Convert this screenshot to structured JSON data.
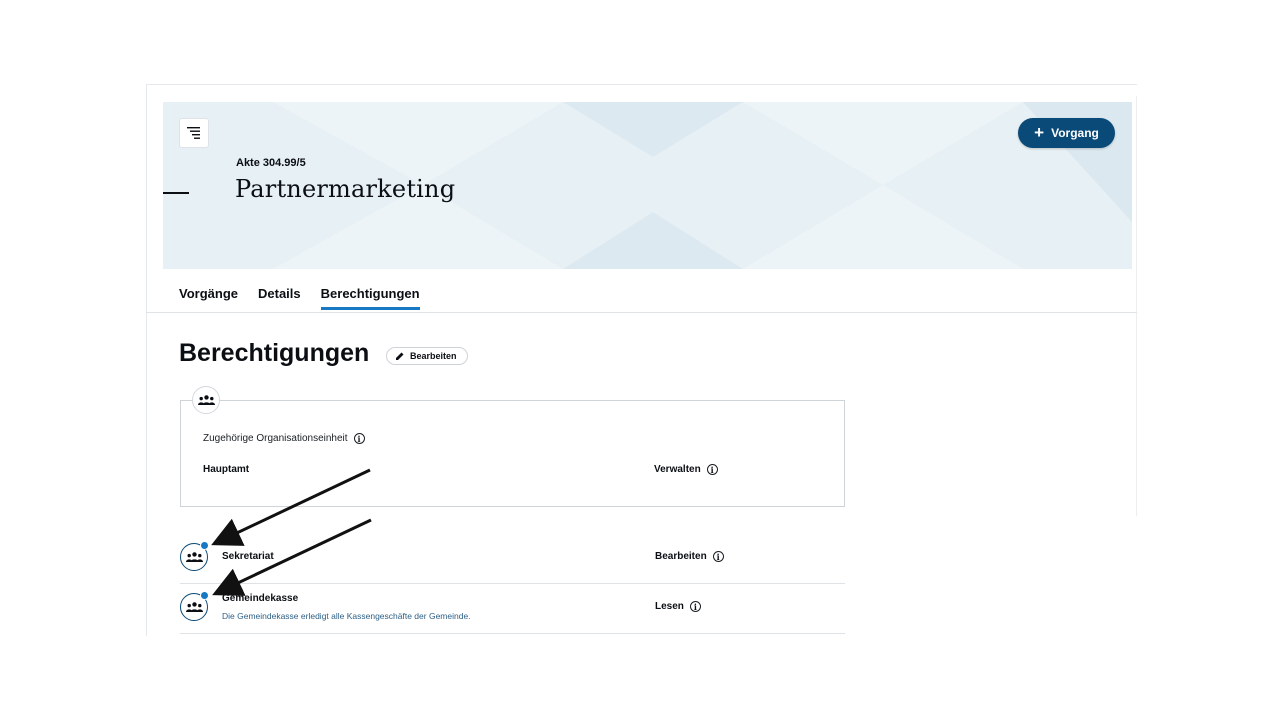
{
  "hero": {
    "akte": "Akte 304.99/5",
    "title": "Partnermarketing",
    "new_button": "Vorgang"
  },
  "tabs": [
    {
      "label": "Vorgänge",
      "active": false
    },
    {
      "label": "Details",
      "active": false
    },
    {
      "label": "Berechtigungen",
      "active": true
    }
  ],
  "section": {
    "title": "Berechtigungen",
    "edit_label": "Bearbeiten"
  },
  "org_card": {
    "label": "Zugehörige Organisationseinheit",
    "unit": "Hauptamt",
    "permission": "Verwalten"
  },
  "rows": [
    {
      "name": "Sekretariat",
      "description": "",
      "permission": "Bearbeiten"
    },
    {
      "name": "Gemeindekasse",
      "description": "Die Gemeindekasse erledigt alle Kassengeschäfte der Gemeinde.",
      "permission": "Lesen"
    }
  ],
  "colors": {
    "accent": "#1779c4",
    "primary_button": "#0a4a78",
    "hero_bg": "#e7f0f5"
  },
  "icons": [
    "tree-list-icon",
    "plus-icon",
    "pencil-icon",
    "group-icon",
    "info-icon"
  ]
}
